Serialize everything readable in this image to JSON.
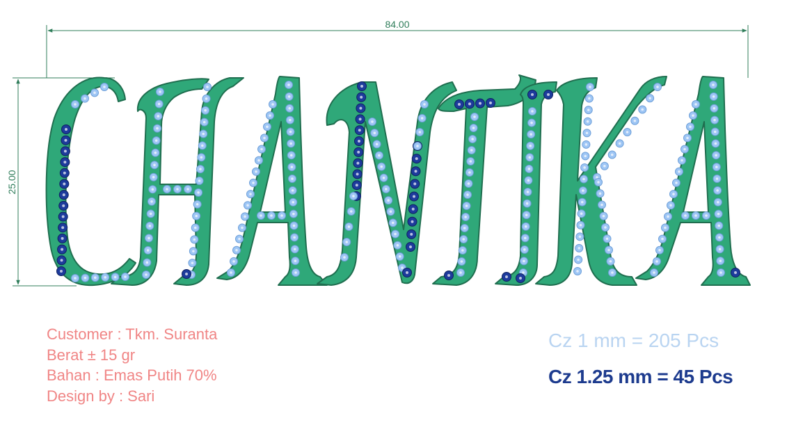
{
  "dimensions": {
    "width": "84.00",
    "height": "25.00"
  },
  "design_text": "CHANTIKA",
  "colors": {
    "body": "#2fa879",
    "outline": "#1f6e4f",
    "stone_small": "#9ec6f5",
    "stone_large": "#1d3b9c",
    "dim_line": "#2f7d5a",
    "info_text": "#f08585"
  },
  "info": {
    "customer": "Customer : Tkm. Suranta",
    "weight": "Berat ± 15 gr",
    "material": "Bahan : Emas Putih 70%",
    "designer": "Design by : Sari"
  },
  "stones": {
    "small": "Cz 1 mm = 205 Pcs",
    "large": "Cz 1.25 mm = 45 Pcs"
  }
}
